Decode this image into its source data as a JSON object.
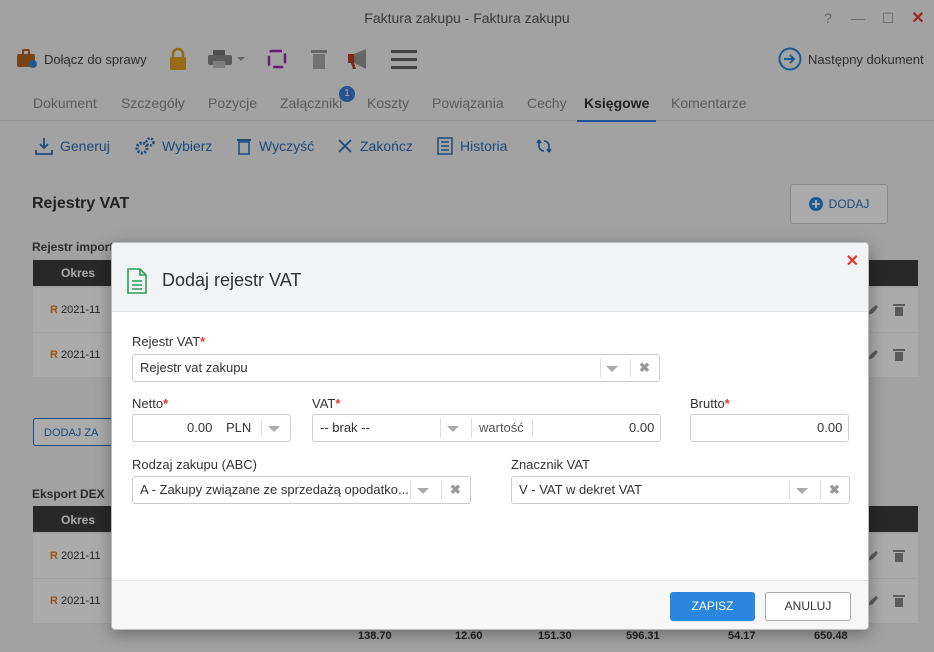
{
  "window": {
    "title": "Faktura zakupu - Faktura zakupu",
    "help": "?",
    "minimize": "—",
    "maximize": "☐",
    "close": "✕"
  },
  "toolbar": {
    "attach_label": "Dołącz do sprawy",
    "next_doc_label": "Następny dokument"
  },
  "tabs": [
    {
      "label": "Dokument"
    },
    {
      "label": "Szczegóły"
    },
    {
      "label": "Pozycje"
    },
    {
      "label": "Załączniki",
      "badge": "1"
    },
    {
      "label": "Koszty"
    },
    {
      "label": "Powiązania"
    },
    {
      "label": "Cechy"
    },
    {
      "label": "Księgowe"
    },
    {
      "label": "Komentarze"
    }
  ],
  "actions": [
    {
      "label": "Generuj"
    },
    {
      "label": "Wybierz"
    },
    {
      "label": "Wyczyść"
    },
    {
      "label": "Zakończ"
    },
    {
      "label": "Historia"
    }
  ],
  "section": {
    "title": "Rejestry VAT",
    "add_label": "DODAJ",
    "import_title": "Rejestr importo",
    "export_title": "Eksport DEX",
    "col_okres": "Okres",
    "add_small_label": "DODAJ ZA",
    "rows_import": [
      {
        "prefix": "R",
        "okres": "2021-11"
      },
      {
        "prefix": "R",
        "okres": "2021-11"
      }
    ],
    "rows_export": [
      {
        "prefix": "R",
        "okres": "2021-11"
      },
      {
        "prefix": "R",
        "okres": "2021-11"
      }
    ],
    "totals": [
      "138.70",
      "12.60",
      "151.30",
      "596.31",
      "54.17",
      "650.48"
    ]
  },
  "modal": {
    "title": "Dodaj rejestr VAT",
    "close": "✕",
    "rejestr_label": "Rejestr VAT",
    "rejestr_value": "Rejestr vat zakupu",
    "netto_label": "Netto",
    "netto_value": "0.00",
    "netto_currency": "PLN",
    "vat_label": "VAT",
    "vat_value": "-- brak --",
    "wartosc_label": "wartość",
    "wartosc_value": "0.00",
    "brutto_label": "Brutto",
    "brutto_value": "0.00",
    "rodzaj_label": "Rodzaj zakupu (ABC)",
    "rodzaj_value": "A - Zakupy związane ze sprzedażą opodatko...",
    "znacznik_label": "Znacznik VAT",
    "znacznik_value": "V - VAT w dekret VAT",
    "save": "ZAPISZ",
    "cancel": "ANULUJ"
  },
  "colors": {
    "accent": "#2b86dd",
    "link": "#2c6fb7",
    "required": "#e53935",
    "header_dark": "#3d3d3d"
  }
}
